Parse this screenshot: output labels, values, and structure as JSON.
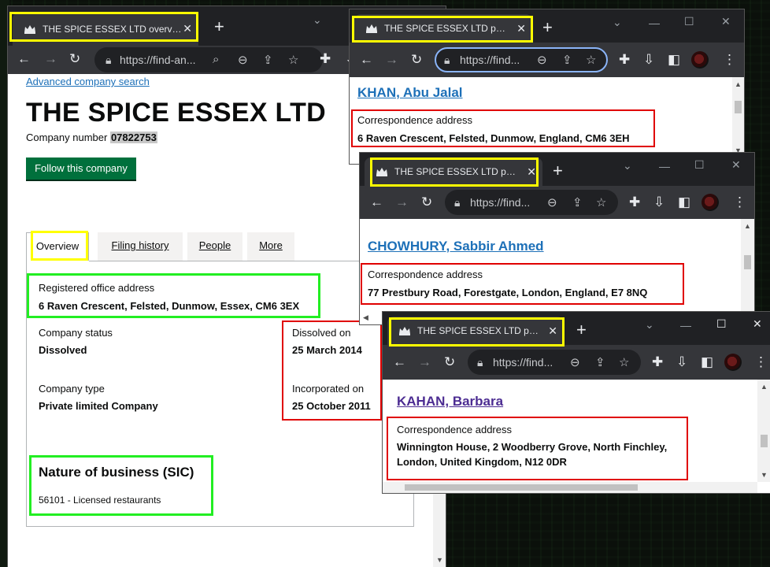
{
  "main": {
    "tab_title": "THE SPICE ESSEX LTD overview - ",
    "url": "https://find-an...",
    "advanced_search": "Advanced company search",
    "company_name": "THE SPICE ESSEX LTD",
    "company_number_label": "Company number",
    "company_number": "07822753",
    "follow_button": "Follow this company",
    "tabs": [
      "Overview",
      "Filing history",
      "People",
      "More"
    ],
    "registered_office_label": "Registered office address",
    "registered_office_value": "6 Raven Crescent, Felsted, Dunmow, Essex, CM6 3EX",
    "status_label": "Company status",
    "status_value": "Dissolved",
    "dissolved_label": "Dissolved on",
    "dissolved_value": "25 March 2014",
    "type_label": "Company type",
    "type_value": "Private limited Company",
    "incorporated_label": "Incorporated on",
    "incorporated_value": "25 October 2011",
    "sic_heading": "Nature of business (SIC)",
    "sic_value": "56101 - Licensed restaurants"
  },
  "win1": {
    "tab_title": "THE SPICE ESSEX LTD people",
    "url": "https://find...",
    "person_name": "KHAN, Abu Jalal",
    "address_label": "Correspondence address",
    "address_value": "6 Raven Crescent, Felsted, Dunmow, England, CM6 3EH"
  },
  "win2": {
    "tab_title": "THE SPICE ESSEX LTD people",
    "url": "https://find...",
    "person_name": "CHOWHURY, Sabbir Ahmed",
    "address_label": "Correspondence address",
    "address_value": "77 Prestbury Road, Forestgate, London, England, E7 8NQ"
  },
  "win3": {
    "tab_title": "THE SPICE ESSEX LTD people",
    "url": "https://find...",
    "person_name": "KAHAN, Barbara",
    "address_label": "Correspondence address",
    "address_line1": "Winnington House, 2 Woodberry Grove, North Finchley,",
    "address_line2": "London, United Kingdom, N12 0DR"
  },
  "colors": {
    "chrome_dark": "#202124",
    "chrome_toolbar": "#35363a",
    "gov_link": "#1d70b8",
    "gov_green": "#00703c",
    "highlight_yellow": "#ffff00",
    "highlight_red": "#e00000",
    "highlight_green": "#22ee22"
  }
}
